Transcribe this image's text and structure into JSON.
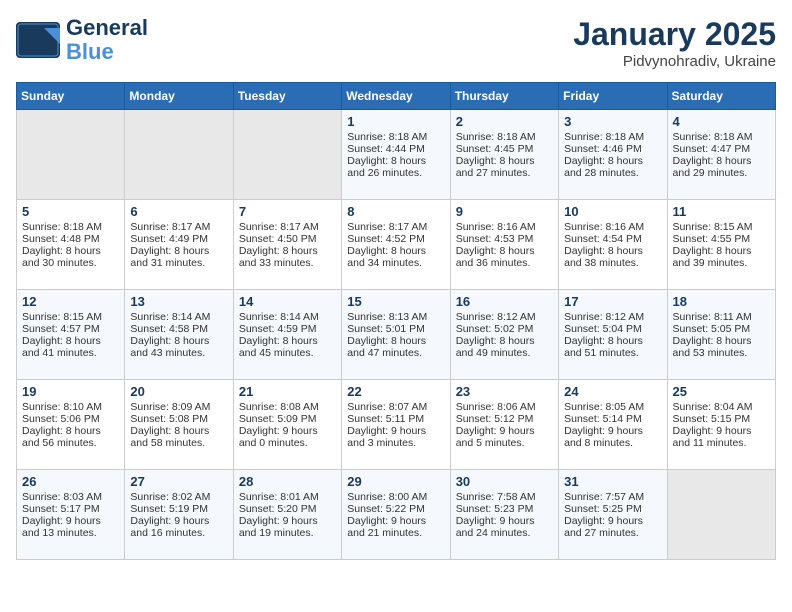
{
  "header": {
    "logo_line1": "General",
    "logo_line2": "Blue",
    "month": "January 2025",
    "location": "Pidvynohradiv, Ukraine"
  },
  "weekdays": [
    "Sunday",
    "Monday",
    "Tuesday",
    "Wednesday",
    "Thursday",
    "Friday",
    "Saturday"
  ],
  "weeks": [
    [
      {
        "day": "",
        "text": ""
      },
      {
        "day": "",
        "text": ""
      },
      {
        "day": "",
        "text": ""
      },
      {
        "day": "1",
        "text": "Sunrise: 8:18 AM\nSunset: 4:44 PM\nDaylight: 8 hours and 26 minutes."
      },
      {
        "day": "2",
        "text": "Sunrise: 8:18 AM\nSunset: 4:45 PM\nDaylight: 8 hours and 27 minutes."
      },
      {
        "day": "3",
        "text": "Sunrise: 8:18 AM\nSunset: 4:46 PM\nDaylight: 8 hours and 28 minutes."
      },
      {
        "day": "4",
        "text": "Sunrise: 8:18 AM\nSunset: 4:47 PM\nDaylight: 8 hours and 29 minutes."
      }
    ],
    [
      {
        "day": "5",
        "text": "Sunrise: 8:18 AM\nSunset: 4:48 PM\nDaylight: 8 hours and 30 minutes."
      },
      {
        "day": "6",
        "text": "Sunrise: 8:17 AM\nSunset: 4:49 PM\nDaylight: 8 hours and 31 minutes."
      },
      {
        "day": "7",
        "text": "Sunrise: 8:17 AM\nSunset: 4:50 PM\nDaylight: 8 hours and 33 minutes."
      },
      {
        "day": "8",
        "text": "Sunrise: 8:17 AM\nSunset: 4:52 PM\nDaylight: 8 hours and 34 minutes."
      },
      {
        "day": "9",
        "text": "Sunrise: 8:16 AM\nSunset: 4:53 PM\nDaylight: 8 hours and 36 minutes."
      },
      {
        "day": "10",
        "text": "Sunrise: 8:16 AM\nSunset: 4:54 PM\nDaylight: 8 hours and 38 minutes."
      },
      {
        "day": "11",
        "text": "Sunrise: 8:15 AM\nSunset: 4:55 PM\nDaylight: 8 hours and 39 minutes."
      }
    ],
    [
      {
        "day": "12",
        "text": "Sunrise: 8:15 AM\nSunset: 4:57 PM\nDaylight: 8 hours and 41 minutes."
      },
      {
        "day": "13",
        "text": "Sunrise: 8:14 AM\nSunset: 4:58 PM\nDaylight: 8 hours and 43 minutes."
      },
      {
        "day": "14",
        "text": "Sunrise: 8:14 AM\nSunset: 4:59 PM\nDaylight: 8 hours and 45 minutes."
      },
      {
        "day": "15",
        "text": "Sunrise: 8:13 AM\nSunset: 5:01 PM\nDaylight: 8 hours and 47 minutes."
      },
      {
        "day": "16",
        "text": "Sunrise: 8:12 AM\nSunset: 5:02 PM\nDaylight: 8 hours and 49 minutes."
      },
      {
        "day": "17",
        "text": "Sunrise: 8:12 AM\nSunset: 5:04 PM\nDaylight: 8 hours and 51 minutes."
      },
      {
        "day": "18",
        "text": "Sunrise: 8:11 AM\nSunset: 5:05 PM\nDaylight: 8 hours and 53 minutes."
      }
    ],
    [
      {
        "day": "19",
        "text": "Sunrise: 8:10 AM\nSunset: 5:06 PM\nDaylight: 8 hours and 56 minutes."
      },
      {
        "day": "20",
        "text": "Sunrise: 8:09 AM\nSunset: 5:08 PM\nDaylight: 8 hours and 58 minutes."
      },
      {
        "day": "21",
        "text": "Sunrise: 8:08 AM\nSunset: 5:09 PM\nDaylight: 9 hours and 0 minutes."
      },
      {
        "day": "22",
        "text": "Sunrise: 8:07 AM\nSunset: 5:11 PM\nDaylight: 9 hours and 3 minutes."
      },
      {
        "day": "23",
        "text": "Sunrise: 8:06 AM\nSunset: 5:12 PM\nDaylight: 9 hours and 5 minutes."
      },
      {
        "day": "24",
        "text": "Sunrise: 8:05 AM\nSunset: 5:14 PM\nDaylight: 9 hours and 8 minutes."
      },
      {
        "day": "25",
        "text": "Sunrise: 8:04 AM\nSunset: 5:15 PM\nDaylight: 9 hours and 11 minutes."
      }
    ],
    [
      {
        "day": "26",
        "text": "Sunrise: 8:03 AM\nSunset: 5:17 PM\nDaylight: 9 hours and 13 minutes."
      },
      {
        "day": "27",
        "text": "Sunrise: 8:02 AM\nSunset: 5:19 PM\nDaylight: 9 hours and 16 minutes."
      },
      {
        "day": "28",
        "text": "Sunrise: 8:01 AM\nSunset: 5:20 PM\nDaylight: 9 hours and 19 minutes."
      },
      {
        "day": "29",
        "text": "Sunrise: 8:00 AM\nSunset: 5:22 PM\nDaylight: 9 hours and 21 minutes."
      },
      {
        "day": "30",
        "text": "Sunrise: 7:58 AM\nSunset: 5:23 PM\nDaylight: 9 hours and 24 minutes."
      },
      {
        "day": "31",
        "text": "Sunrise: 7:57 AM\nSunset: 5:25 PM\nDaylight: 9 hours and 27 minutes."
      },
      {
        "day": "",
        "text": ""
      }
    ]
  ]
}
